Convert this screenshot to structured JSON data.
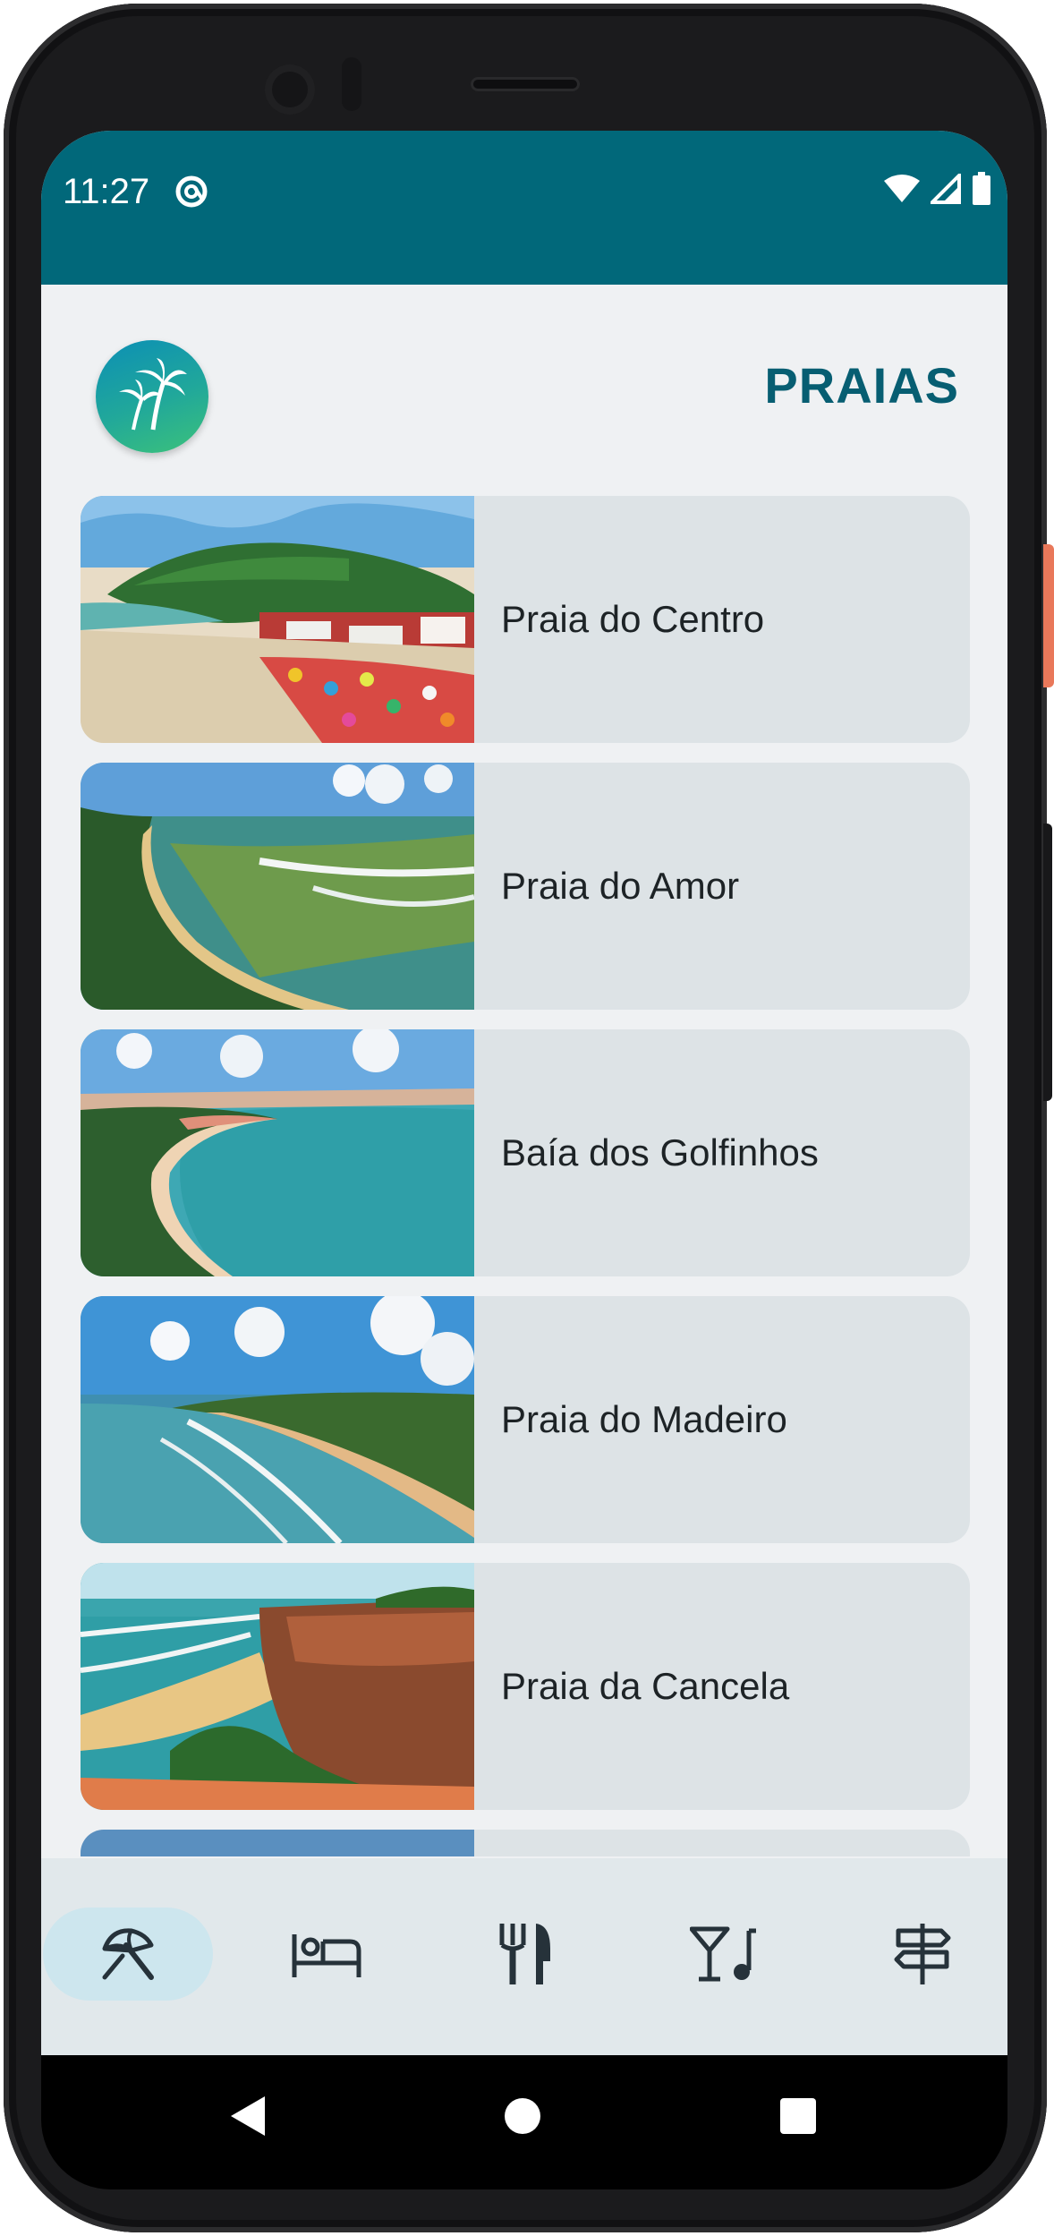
{
  "status_bar": {
    "time": "11:27",
    "background_color": "#01687a",
    "icons": [
      "at-sign-icon",
      "wifi-icon",
      "signal-icon",
      "battery-icon"
    ]
  },
  "header": {
    "logo_icon": "palm-trees-icon",
    "title": "PRAIAS",
    "title_color": "#075e72"
  },
  "beaches": [
    {
      "name": "Praia do Centro"
    },
    {
      "name": "Praia do Amor"
    },
    {
      "name": "Baía dos Golfinhos"
    },
    {
      "name": "Praia do Madeiro"
    },
    {
      "name": "Praia da Cancela"
    },
    {
      "name": ""
    }
  ],
  "bottom_nav": {
    "active_index": 0,
    "items": [
      {
        "icon": "beach-umbrella-icon"
      },
      {
        "icon": "bed-icon"
      },
      {
        "icon": "fork-knife-icon"
      },
      {
        "icon": "cocktail-music-icon"
      },
      {
        "icon": "signpost-icon"
      }
    ]
  },
  "system_nav": {
    "icons": [
      "back-icon",
      "home-icon",
      "recents-icon"
    ]
  }
}
